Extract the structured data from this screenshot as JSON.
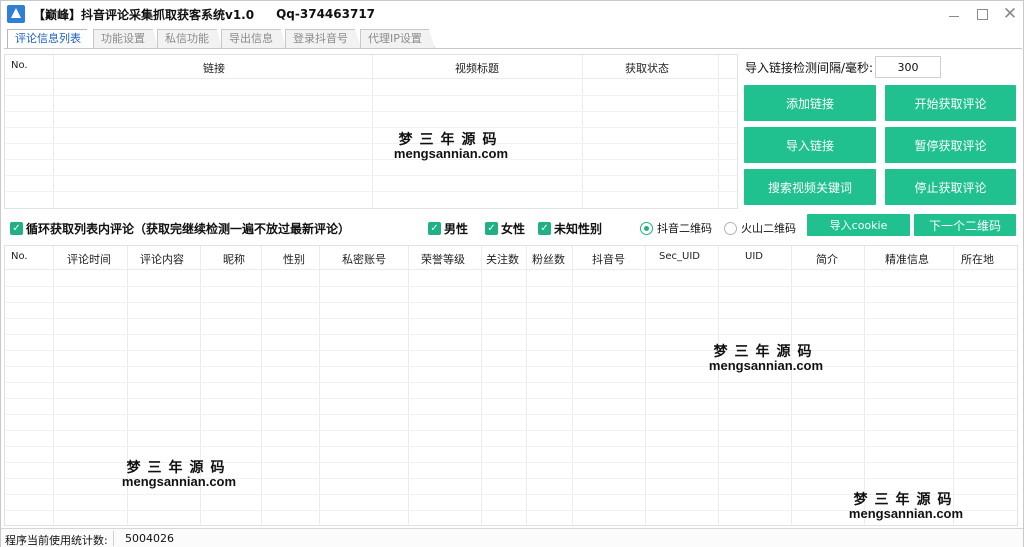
{
  "window": {
    "title": "【巅峰】抖音评论采集抓取获客系统v1.0",
    "qq": "Qq-374463717"
  },
  "tabs": [
    {
      "label": "评论信息列表",
      "active": true
    },
    {
      "label": "功能设置"
    },
    {
      "label": "私信功能"
    },
    {
      "label": "导出信息"
    },
    {
      "label": "登录抖音号"
    },
    {
      "label": "代理IP设置"
    }
  ],
  "link_table": {
    "columns": [
      "No.",
      "链接",
      "视频标题",
      "获取状态"
    ]
  },
  "interval": {
    "label": "导入链接检测间隔/毫秒:",
    "value": "300"
  },
  "buttons": {
    "add_link": "添加链接",
    "start_comments": "开始获取评论",
    "import_link": "导入链接",
    "pause_comments": "暂停获取评论",
    "search_keyword": "搜索视频关键词",
    "stop_comments": "停止获取评论",
    "import_cookie": "导入cookie",
    "next_qrcode": "下一个二维码"
  },
  "options": {
    "loop_label": "循环获取列表内评论（获取完继续检测一遍不放过最新评论）",
    "male": "男性",
    "female": "女性",
    "unknown_gender": "未知性别",
    "douyin_qr": "抖音二维码",
    "huoshan_qr": "火山二维码"
  },
  "comment_table": {
    "columns": [
      "No.",
      "评论时间",
      "评论内容",
      "昵称",
      "性别",
      "私密账号",
      "荣誉等级",
      "关注数",
      "粉丝数",
      "抖音号",
      "Sec_UID",
      "UID",
      "简介",
      "精准信息",
      "所在地"
    ]
  },
  "watermark": {
    "cn": "梦三年源码",
    "en": "mengsannian.com"
  },
  "status": {
    "label": "程序当前使用统计数:",
    "value": "5004026"
  },
  "colors": {
    "accent_green": "#20c08f",
    "active_tab_text": "#1d5fc0"
  }
}
